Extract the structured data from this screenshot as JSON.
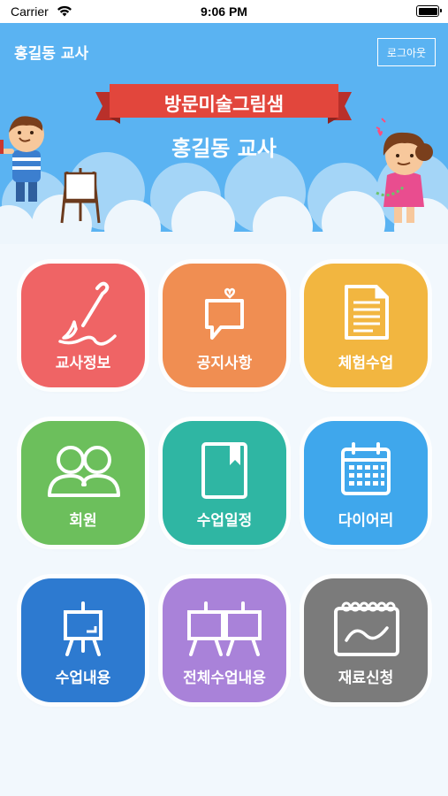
{
  "status_bar": {
    "carrier": "Carrier",
    "time": "9:06 PM"
  },
  "header": {
    "title": "홍길동 교사",
    "logout_label": "로그아웃",
    "banner_text": "방문미술그림샘",
    "teacher_name": "홍길동 교사",
    "bg_color": "#5ab3f2"
  },
  "menu": {
    "items": [
      {
        "label": "교사정보",
        "color": "#ef6465",
        "icon": "brush-icon"
      },
      {
        "label": "공지사항",
        "color": "#f08e52",
        "icon": "message-heart-icon"
      },
      {
        "label": "체험수업",
        "color": "#f2b640",
        "icon": "document-icon"
      },
      {
        "label": "회원",
        "color": "#6cbf5c",
        "icon": "members-icon"
      },
      {
        "label": "수업일정",
        "color": "#2fb6a3",
        "icon": "bookmark-book-icon"
      },
      {
        "label": "다이어리",
        "color": "#3fa7ec",
        "icon": "calendar-icon"
      },
      {
        "label": "수업내용",
        "color": "#2d7ad0",
        "icon": "easel-icon"
      },
      {
        "label": "전체수업내용",
        "color": "#a982d9",
        "icon": "double-easel-icon"
      },
      {
        "label": "재료신청",
        "color": "#7b7b7b",
        "icon": "sketchbook-icon"
      }
    ]
  }
}
